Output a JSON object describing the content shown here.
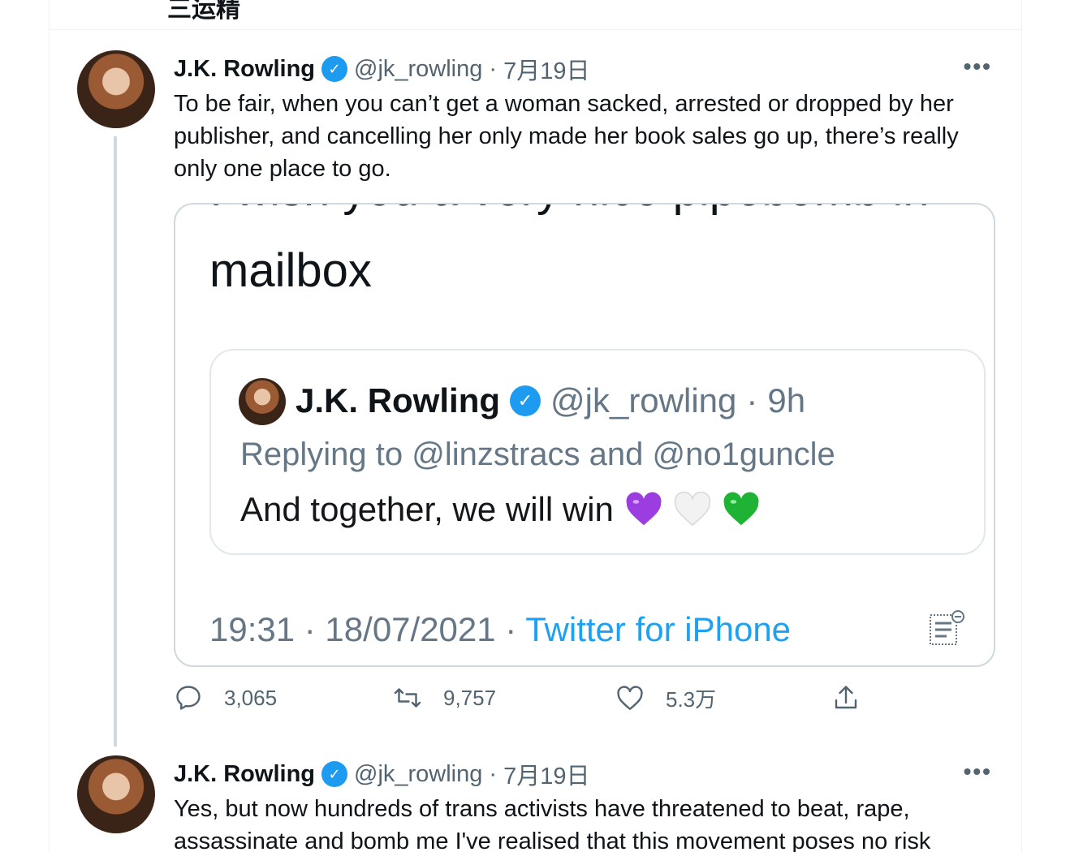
{
  "previous_tweet": {
    "clipped_text": "三运精"
  },
  "tweets": [
    {
      "author_name": "J.K. Rowling",
      "handle": "@jk_rowling",
      "date_sep": "·",
      "date": "7月19日",
      "more": "•••",
      "text": "To be fair, when you can’t get a woman sacked, arrested or dropped by her publisher, and cancelling her only made her book sales go up, there’s really only one place to go.",
      "media": {
        "top_clipped_text": "I wish you a very nice pipebomb in",
        "mailbox_text": "mailbox",
        "quoted": {
          "author_name": "J.K. Rowling",
          "handle": "@jk_rowling",
          "sep": "·",
          "time": "9h",
          "replying": "Replying to @linzstracs and @no1guncle",
          "text": "And together, we will win"
        },
        "meta_time": "19:31 · 18/07/2021 ·",
        "meta_app": "Twitter for iPhone"
      },
      "actions": {
        "replies": "3,065",
        "retweets": "9,757",
        "likes": "5.3万"
      }
    },
    {
      "author_name": "J.K. Rowling",
      "handle": "@jk_rowling",
      "date_sep": "·",
      "date": "7月19日",
      "more": "•••",
      "text": "Yes, but now hundreds of trans activists have threatened to beat, rape, assassinate and bomb me I've realised that this movement poses no risk"
    }
  ],
  "colors": {
    "accent": "#1d9bf0",
    "secondary_text": "#536471",
    "border": "#cfd9de",
    "purple_heart": "#9b3de0",
    "green_heart": "#1fb336"
  },
  "icons": [
    "verified-badge-icon",
    "reply-icon",
    "retweet-icon",
    "like-icon",
    "share-icon",
    "notes-icon",
    "purple-heart-icon",
    "white-heart-icon",
    "green-heart-icon"
  ]
}
